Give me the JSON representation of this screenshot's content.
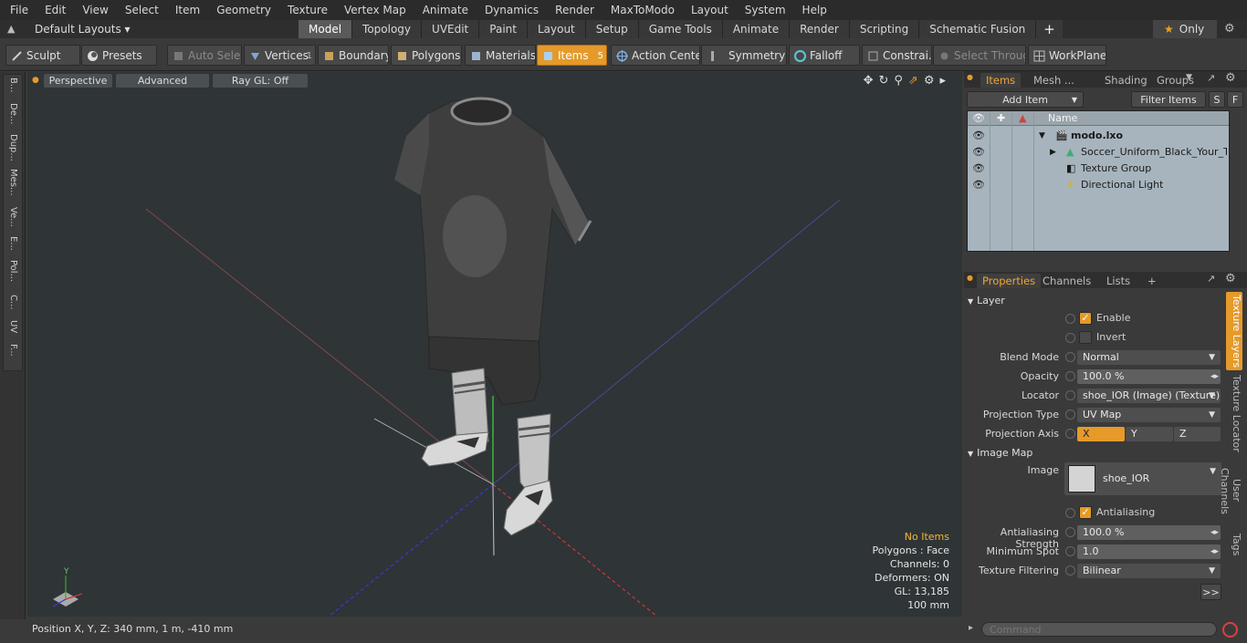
{
  "menu": [
    "File",
    "Edit",
    "View",
    "Select",
    "Item",
    "Geometry",
    "Texture",
    "Vertex Map",
    "Animate",
    "Dynamics",
    "Render",
    "MaxToModo",
    "Layout",
    "System",
    "Help"
  ],
  "layout_selector": "Default Layouts ▾",
  "workspace_tabs": [
    "Model",
    "Topology",
    "UVEdit",
    "Paint",
    "Layout",
    "Setup",
    "Game Tools",
    "Animate",
    "Render",
    "Scripting",
    "Schematic Fusion"
  ],
  "active_tab": "Model",
  "plus_label": "+",
  "only_label": "Only",
  "toolbar": {
    "sculpt": "Sculpt",
    "presets": "Presets",
    "auto_select": "Auto Select",
    "vertices": "Vertices",
    "vertices_count": "1",
    "boundary": "Boundary",
    "polygons": "Polygons",
    "materials": "Materials",
    "items": "Items",
    "items_count": "5",
    "action_center": "Action Center",
    "symmetry": "Symmetry",
    "falloff": "Falloff",
    "constraints": "Constrai...",
    "select_through": "Select Through",
    "workplane": "WorkPlane"
  },
  "left_strip": [
    "B...",
    "De...",
    "Dup...",
    "Mes...",
    "Ve...",
    "E...",
    "Pol...",
    "C...",
    "UV",
    "F..."
  ],
  "viewport": {
    "perspective": "Perspective",
    "advanced": "Advanced",
    "raygl": "Ray GL: Off",
    "stats": {
      "no_items": "No Items",
      "polygons": "Polygons : Face",
      "channels": "Channels: 0",
      "deformers": "Deformers: ON",
      "gl": "GL: 13,185",
      "scale": "100 mm"
    },
    "axis_y": "Y"
  },
  "status": "Position X, Y, Z:  340 mm, 1 m, -410 mm",
  "items_panel": {
    "tabs": [
      "Items",
      "Mesh ...",
      "Shading",
      "Groups"
    ],
    "add_item": "Add Item",
    "filter_items": "Filter Items",
    "s_btn": "S",
    "f_btn": "F",
    "name_col": "Name",
    "rows": [
      "modo.lxo",
      "Soccer_Uniform_Black_Your_T ...",
      "Texture Group",
      "Directional Light"
    ]
  },
  "props_panel": {
    "tabs": [
      "Properties",
      "Channels",
      "Lists"
    ],
    "plus": "+",
    "layer_section": "Layer",
    "enable": "Enable",
    "invert": "Invert",
    "blend_mode_label": "Blend Mode",
    "blend_mode": "Normal",
    "opacity_label": "Opacity",
    "opacity": "100.0 %",
    "locator_label": "Locator",
    "locator": "shoe_IOR (Image) (Texture)",
    "projection_type_label": "Projection Type",
    "projection_type": "UV Map",
    "projection_axis_label": "Projection Axis",
    "axis_x": "X",
    "axis_y": "Y",
    "axis_z": "Z",
    "image_map_section": "Image Map",
    "image_label": "Image",
    "image_name": "shoe_IOR",
    "antialiasing": "Antialiasing",
    "aa_strength_label": "Antialiasing Strength",
    "aa_strength": "100.0 %",
    "min_spot_label": "Minimum Spot",
    "min_spot": "1.0",
    "tex_filter_label": "Texture Filtering",
    "tex_filter": "Bilinear",
    "more": ">>",
    "side_tabs": [
      "Texture Layers",
      "Texture Locator",
      "User Channels",
      "Tags"
    ]
  },
  "command_placeholder": "Command",
  "colors": {
    "accent": "#e59a2a",
    "viewport_bg": "#2f3436",
    "tree_bg": "#a7b4bd"
  }
}
